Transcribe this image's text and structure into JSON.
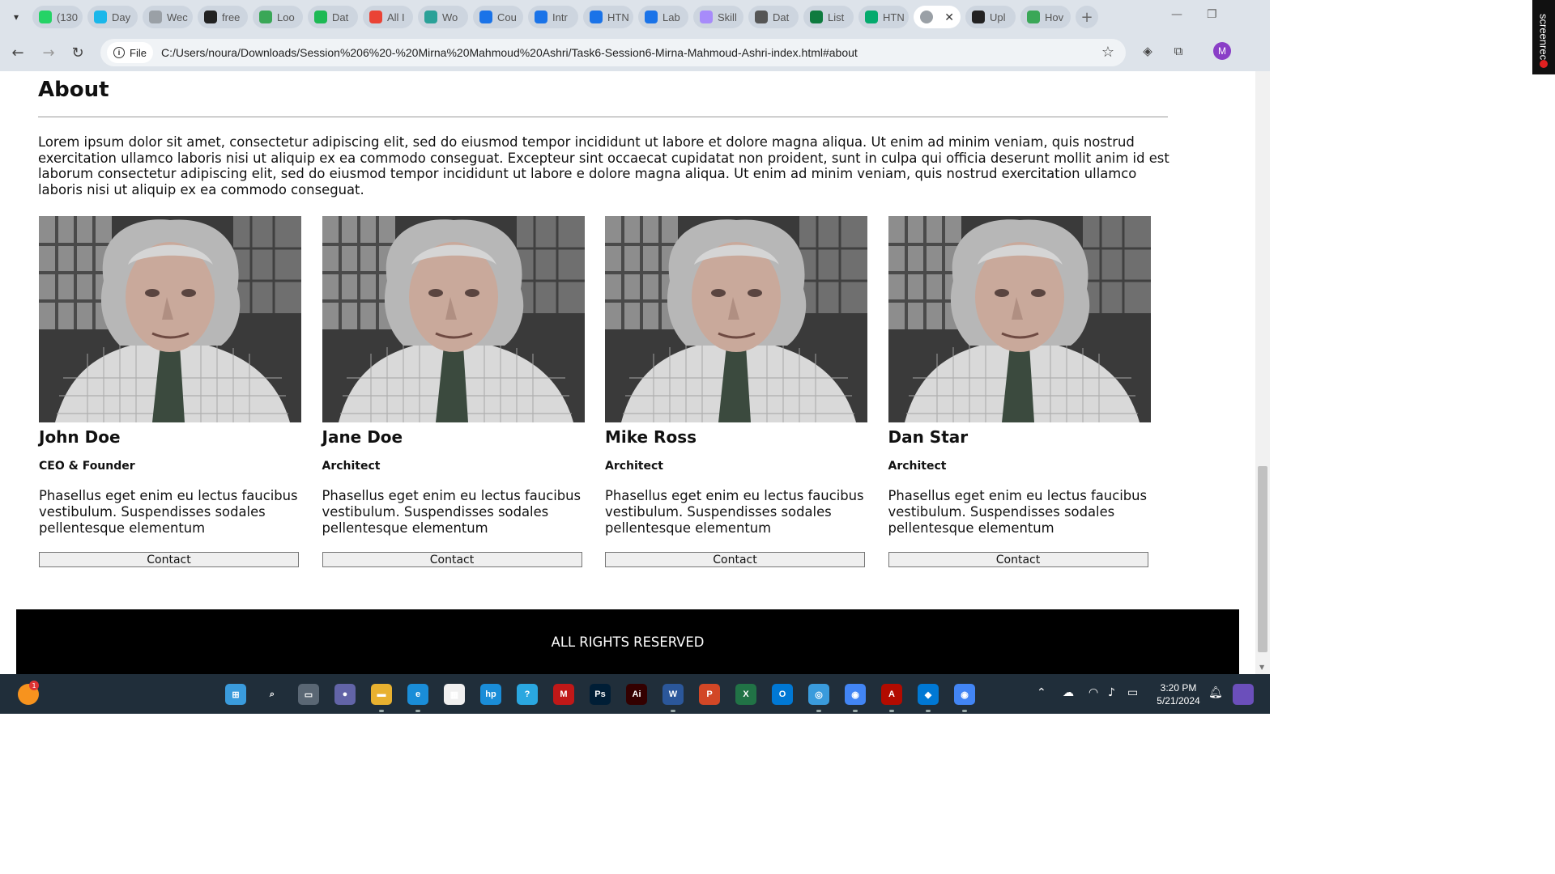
{
  "browser": {
    "tabs": [
      {
        "label": "(130",
        "icon": "whatsapp-icon",
        "color": "#25d366"
      },
      {
        "label": "Day",
        "icon": "vimeo-icon",
        "color": "#1ab7ea"
      },
      {
        "label": "Wec",
        "icon": "globe-icon",
        "color": "#9aa0a6"
      },
      {
        "label": "free",
        "icon": "app-icon",
        "color": "#222222"
      },
      {
        "label": "Loo",
        "icon": "app-icon",
        "color": "#3aa757"
      },
      {
        "label": "Dat",
        "icon": "app-icon",
        "color": "#1db954"
      },
      {
        "label": "All I",
        "icon": "gmail-icon",
        "color": "#ea4335"
      },
      {
        "label": "Wo",
        "icon": "wordpress-icon",
        "color": "#2aa198"
      },
      {
        "label": "Cou",
        "icon": "c-icon",
        "color": "#1a73e8"
      },
      {
        "label": "Intr",
        "icon": "c-icon",
        "color": "#1a73e8"
      },
      {
        "label": "HTN",
        "icon": "c-icon",
        "color": "#1a73e8"
      },
      {
        "label": "Lab",
        "icon": "c-icon",
        "color": "#1a73e8"
      },
      {
        "label": "Skill",
        "icon": "app-icon",
        "color": "#a78bfa"
      },
      {
        "label": "Dat",
        "icon": "openai-icon",
        "color": "#555555"
      },
      {
        "label": "List",
        "icon": "v-icon",
        "color": "#0f7b3f"
      },
      {
        "label": "HTN",
        "icon": "w3schools-icon",
        "color": "#04aa6d"
      }
    ],
    "active_tab_close": "✕",
    "after_tabs": [
      {
        "label": "Upl",
        "icon": "github-icon",
        "color": "#222222"
      },
      {
        "label": "Hov",
        "icon": "app-icon",
        "color": "#3aa757"
      }
    ],
    "file_chip": "File",
    "url": "C:/Users/noura/Downloads/Session%206%20-%20Mirna%20Mahmoud%20Ashri/Task6-Session6-Mirna-Mahmoud-Ashri-index.html#about",
    "profile_initial": "M",
    "screenrec_label": "screenrec"
  },
  "page": {
    "about_title": "About",
    "about_text": "Lorem ipsum dolor sit amet, consectetur adipiscing elit, sed do eiusmod tempor incididunt ut labore et dolore magna aliqua. Ut enim ad minim veniam, quis nostrud exercitation ullamco laboris nisi ut aliquip ex ea commodo conseguat. Excepteur sint occaecat cupidatat non proident, sunt in culpa qui officia deserunt mollit anim id est laborum consectetur adipiscing elit, sed do eiusmod tempor incididunt ut labore e dolore magna aliqua. Ut enim ad minim veniam, quis nostrud exercitation ullamco laboris nisi ut aliquip ex ea commodo conseguat.",
    "team": [
      {
        "name": "John Doe",
        "role": "CEO & Founder",
        "bio": "Phasellus eget enim eu lectus faucibus vestibulum. Suspendisses sodales pellentesque elementum",
        "button": "Contact"
      },
      {
        "name": "Jane Doe",
        "role": "Architect",
        "bio": "Phasellus eget enim eu lectus faucibus vestibulum. Suspendisses sodales pellentesque elementum",
        "button": "Contact"
      },
      {
        "name": "Mike Ross",
        "role": "Architect",
        "bio": "Phasellus eget enim eu lectus faucibus vestibulum. Suspendisses sodales pellentesque elementum",
        "button": "Contact"
      },
      {
        "name": "Dan Star",
        "role": "Architect",
        "bio": "Phasellus eget enim eu lectus faucibus vestibulum. Suspendisses sodales pellentesque elementum",
        "button": "Contact"
      }
    ],
    "footer": "ALL RIGHTS RESERVED"
  },
  "taskbar": {
    "time": "3:20 PM",
    "date": "5/21/2024",
    "notification_count": "1",
    "apps": [
      {
        "name": "start",
        "color": "#3a9bdc",
        "glyph": "⊞"
      },
      {
        "name": "search",
        "color": "#202e3a",
        "glyph": "⌕"
      },
      {
        "name": "task-view",
        "color": "#5a6774",
        "glyph": "▭"
      },
      {
        "name": "teams",
        "color": "#6264a7",
        "glyph": "●"
      },
      {
        "name": "file-explorer",
        "color": "#e8b130",
        "glyph": "▬"
      },
      {
        "name": "edge",
        "color": "#1a8dd8",
        "glyph": "e"
      },
      {
        "name": "store",
        "color": "#f0f0f0",
        "glyph": "▦"
      },
      {
        "name": "myhp",
        "color": "#1a8dd8",
        "glyph": "hp"
      },
      {
        "name": "help",
        "color": "#2aa7e0",
        "glyph": "?"
      },
      {
        "name": "mcafee",
        "color": "#c01818",
        "glyph": "M"
      },
      {
        "name": "photoshop",
        "color": "#001e36",
        "glyph": "Ps"
      },
      {
        "name": "illustrator",
        "color": "#330000",
        "glyph": "Ai"
      },
      {
        "name": "word",
        "color": "#2b579a",
        "glyph": "W"
      },
      {
        "name": "powerpoint",
        "color": "#d24726",
        "glyph": "P"
      },
      {
        "name": "excel",
        "color": "#217346",
        "glyph": "X"
      },
      {
        "name": "outlook",
        "color": "#0078d4",
        "glyph": "O"
      },
      {
        "name": "dock-app",
        "color": "#3a9bdc",
        "glyph": "◎"
      },
      {
        "name": "chrome",
        "color": "#4285f4",
        "glyph": "◉"
      },
      {
        "name": "acrobat",
        "color": "#b30b00",
        "glyph": "A"
      },
      {
        "name": "vscode",
        "color": "#0078d4",
        "glyph": "◆"
      },
      {
        "name": "chrome-2",
        "color": "#4285f4",
        "glyph": "◉"
      }
    ]
  }
}
